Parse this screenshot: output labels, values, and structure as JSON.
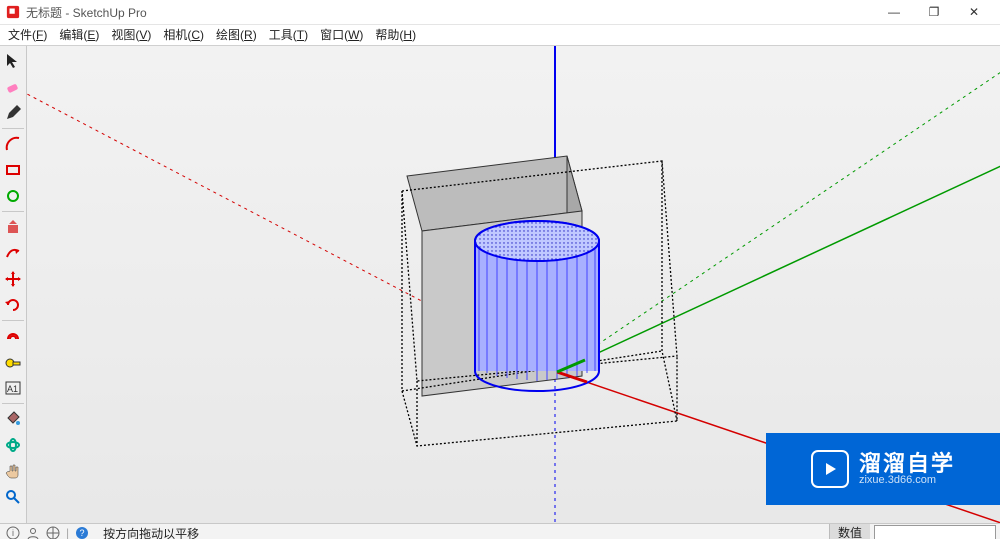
{
  "window": {
    "title": "无标题 - SketchUp Pro",
    "minimize": "—",
    "maximize": "❐",
    "close": "✕"
  },
  "menu": [
    {
      "label": "文件",
      "key": "F"
    },
    {
      "label": "编辑",
      "key": "E"
    },
    {
      "label": "视图",
      "key": "V"
    },
    {
      "label": "相机",
      "key": "C"
    },
    {
      "label": "绘图",
      "key": "R"
    },
    {
      "label": "工具",
      "key": "T"
    },
    {
      "label": "窗口",
      "key": "W"
    },
    {
      "label": "帮助",
      "key": "H"
    }
  ],
  "tools": [
    {
      "name": "select-tool",
      "icon": "cursor"
    },
    {
      "name": "eraser-tool",
      "icon": "eraser"
    },
    {
      "name": "line-tool",
      "icon": "pencil"
    },
    {
      "name": "sep"
    },
    {
      "name": "arc-tool",
      "icon": "arc"
    },
    {
      "name": "rectangle-tool",
      "icon": "rect"
    },
    {
      "name": "circle-tool",
      "icon": "circle"
    },
    {
      "name": "sep"
    },
    {
      "name": "pushpull-tool",
      "icon": "pushpull"
    },
    {
      "name": "followme-tool",
      "icon": "followme"
    },
    {
      "name": "move-tool",
      "icon": "move"
    },
    {
      "name": "rotate-tool",
      "icon": "rotate"
    },
    {
      "name": "sep"
    },
    {
      "name": "offset-tool",
      "icon": "offset"
    },
    {
      "name": "tape-tool",
      "icon": "tape"
    },
    {
      "name": "text-tool",
      "icon": "text"
    },
    {
      "name": "sep"
    },
    {
      "name": "paint-tool",
      "icon": "bucket"
    },
    {
      "name": "orbit-tool",
      "icon": "orbit"
    },
    {
      "name": "pan-tool",
      "icon": "pan"
    },
    {
      "name": "zoom-tool",
      "icon": "zoom"
    }
  ],
  "status": {
    "hint": "按方向拖动以平移",
    "vcb_label": "数值",
    "vcb_value": ""
  },
  "overlay": {
    "brand": "溜溜自学",
    "url": "zixue.3d66.com"
  },
  "scene": {
    "axes": {
      "red": "#d40000",
      "green": "#009a00",
      "blue": "#0000f0"
    },
    "cube": {
      "edge_color": "#333333",
      "face_top": "#bcbcbc",
      "face_front": "#c9c9c9",
      "face_side": "#a8a8a8"
    },
    "selection_box": {
      "stroke": "#000000"
    },
    "cylinder": {
      "stroke": "#0000f0",
      "fill": "#a8b0ff"
    }
  }
}
